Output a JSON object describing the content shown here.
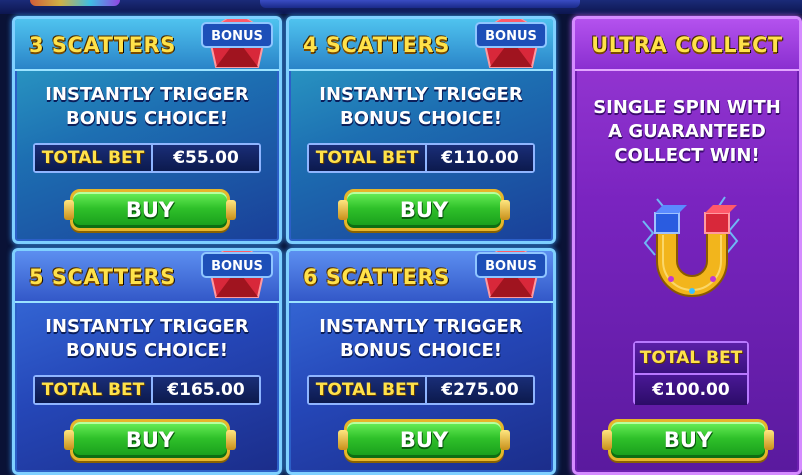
{
  "header": {
    "logo": "game-logo",
    "title_bar": "title-banner"
  },
  "cards": [
    {
      "id": "3",
      "title": "3  SCATTERS",
      "badge": "BONUS",
      "line1": "INSTANTLY TRIGGER",
      "line2": "BONUS CHOICE!",
      "bet_label": "TOTAL BET",
      "bet_value": "€55.00",
      "buy_label": "BUY"
    },
    {
      "id": "4",
      "title": "4  SCATTERS",
      "badge": "BONUS",
      "line1": "INSTANTLY TRIGGER",
      "line2": "BONUS CHOICE!",
      "bet_label": "TOTAL BET",
      "bet_value": "€110.00",
      "buy_label": "BUY"
    },
    {
      "id": "5",
      "title": "5  SCATTERS",
      "badge": "BONUS",
      "line1": "INSTANTLY TRIGGER",
      "line2": "BONUS CHOICE!",
      "bet_label": "TOTAL BET",
      "bet_value": "€165.00",
      "buy_label": "BUY"
    },
    {
      "id": "6",
      "title": "6  SCATTERS",
      "badge": "BONUS",
      "line1": "INSTANTLY TRIGGER",
      "line2": "BONUS CHOICE!",
      "bet_label": "TOTAL BET",
      "bet_value": "€275.00",
      "buy_label": "BUY"
    }
  ],
  "ultra": {
    "title": "ULTRA COLLECT",
    "line1": "SINGLE SPIN WITH",
    "line2": "A GUARANTEED",
    "line3": "COLLECT WIN!",
    "icon": "magnet-icon",
    "bet_label": "TOTAL BET",
    "bet_value": "€100.00",
    "buy_label": "BUY"
  },
  "colors": {
    "accent_yellow": "#ffe24a",
    "buy_green": "#2fc12a",
    "purple": "#7a24c0",
    "teal": "#2ea7c9",
    "blue": "#2547b8"
  }
}
